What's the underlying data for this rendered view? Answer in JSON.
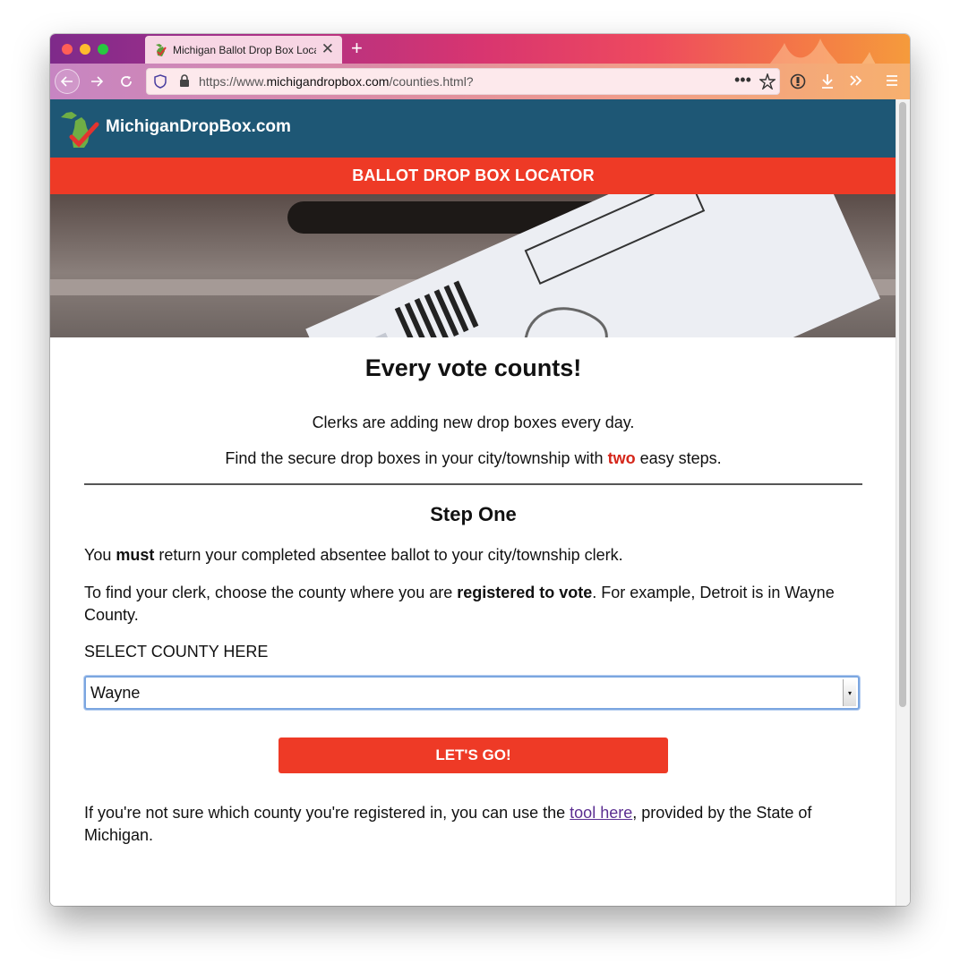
{
  "browser": {
    "tab_title": "Michigan Ballot Drop Box Locat",
    "new_tab_symbol": "+",
    "url_prefix": "https://www.",
    "url_host": "michigandropbox.com",
    "url_path": "/counties.html?"
  },
  "site": {
    "logo_text": "MichiganDropBox.com",
    "banner": "BALLOT DROP BOX LOCATOR"
  },
  "main": {
    "heading": "Every vote counts!",
    "intro_line1": "Clerks are adding new drop boxes every day.",
    "intro_line2_before": "Find the secure drop boxes in your city/township with ",
    "intro_line2_emph": "two",
    "intro_line2_after": " easy steps.",
    "step_title": "Step One",
    "must_before": "You ",
    "must_emph": "must",
    "must_after": " return your completed absentee ballot to your city/township clerk.",
    "find_before": "To find your clerk, choose the county where you are ",
    "find_emph": "registered to vote",
    "find_after": ". For example, Detroit is in Wayne County.",
    "select_label": "SELECT COUNTY HERE",
    "select_value": "Wayne",
    "button_label": "LET'S GO!",
    "help_before": "If you're not sure which county you're registered in, you can use the ",
    "help_link": "tool here",
    "help_after": ", provided by the State of Michigan."
  },
  "colors": {
    "header_blue": "#1e5775",
    "banner_red": "#ee3a26",
    "button_red": "#ee3a26",
    "link_purple": "#5b2e91"
  },
  "icons": [
    "back-arrow-icon",
    "forward-arrow-icon",
    "reload-icon",
    "shield-icon",
    "lock-icon",
    "more-icon",
    "star-icon",
    "extension-icon",
    "download-icon",
    "overflow-icon",
    "menu-icon",
    "close-icon",
    "michigan-logo-icon"
  ]
}
